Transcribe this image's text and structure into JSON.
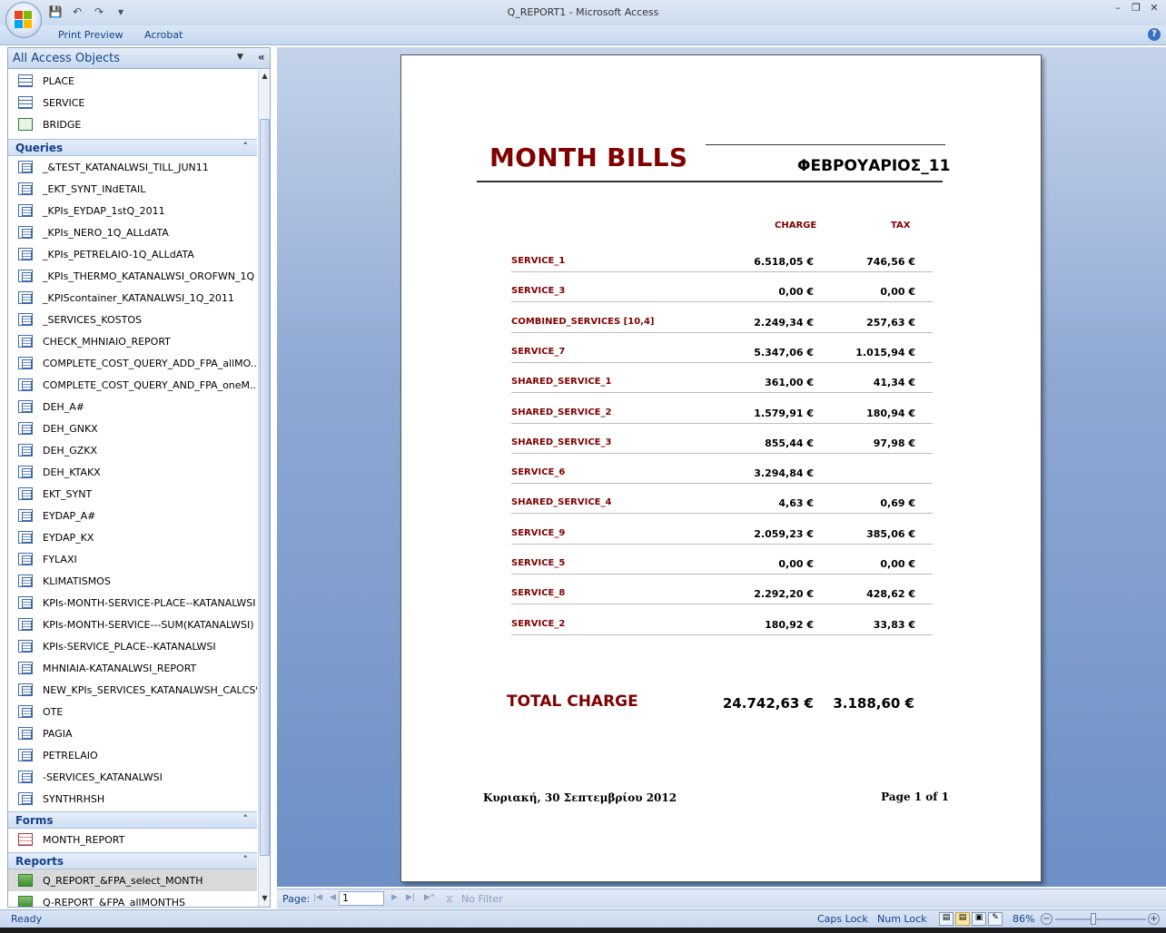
{
  "window": {
    "title": "Q_REPORT1 - Microsoft Access"
  },
  "ribbon": {
    "tabs": [
      "Print Preview",
      "Acrobat"
    ]
  },
  "nav": {
    "header": "All Access Objects",
    "tables": [
      "PLACE",
      "SERVICE",
      "BRIDGE"
    ],
    "groups": {
      "queries": "Queries",
      "forms": "Forms",
      "reports": "Reports"
    },
    "queries": [
      "_&TEST_KATANALWSI_TILL_JUN11",
      "_EKT_SYNT_INdETAIL",
      "_KPIs_EYDAP_1stQ_2011",
      "_KPIs_NERO_1Q_ALLdATA",
      "_KPIs_PETRELAIO-1Q_ALLdATA",
      "_KPIs_THERMO_KATANALWSI_OROFWN_1Q",
      "_KPIScontainer_KATANALWSI_1Q_2011",
      "_SERVICES_KOSTOS",
      "CHECK_MHNIAIO_REPORT",
      "COMPLETE_COST_QUERY_ADD_FPA_allMO...",
      "COMPLETE_COST_QUERY_AND_FPA_oneM...",
      "DEH_A#",
      "DEH_GNKX",
      "DEH_GZKX",
      "DEH_KTAKX",
      "EKT_SYNT",
      "EYDAP_A#",
      "EYDAP_KX",
      "FYLAXI",
      "KLIMATISMOS",
      "KPIs-MONTH-SERVICE-PLACE--KATANALWSI",
      "KPIs-MONTH-SERVICE---SUM(KATANALWSI)",
      "KPIs-SERVICE_PLACE--KATANALWSI",
      "MHNIAIA-KATANALWSI_REPORT",
      "NEW_KPIs_SERVICES_KATANALWSH_CALCS%",
      "OTE",
      "PAGIA",
      "PETRELAIO",
      "-SERVICES_KATANALWSI",
      "SYNTHRHSH"
    ],
    "forms": [
      "MONTH_REPORT"
    ],
    "reports": [
      "Q_REPORT_&FPA_select_MONTH",
      "Q-REPORT_&FPA_allMONTHS"
    ]
  },
  "report": {
    "title": "MONTH BILLS",
    "month": "ΦΕΒΡΟΥΑΡΙΟΣ_11",
    "col_charge": "CHARGE",
    "col_tax": "TAX",
    "rows": [
      {
        "name": "SERVICE_1",
        "charge": "6.518,05 €",
        "tax": "746,56 €"
      },
      {
        "name": "SERVICE_3",
        "charge": "0,00 €",
        "tax": "0,00 €"
      },
      {
        "name": "COMBINED_SERVICES [10,4]",
        "charge": "2.249,34 €",
        "tax": "257,63 €"
      },
      {
        "name": "SERVICE_7",
        "charge": "5.347,06 €",
        "tax": "1.015,94 €"
      },
      {
        "name": "SHARED_SERVICE_1",
        "charge": "361,00 €",
        "tax": "41,34 €"
      },
      {
        "name": "SHARED_SERVICE_2",
        "charge": "1.579,91 €",
        "tax": "180,94 €"
      },
      {
        "name": "SHARED_SERVICE_3",
        "charge": "855,44 €",
        "tax": "97,98 €"
      },
      {
        "name": "SERVICE_6",
        "charge": "3.294,84 €",
        "tax": ""
      },
      {
        "name": "SHARED_SERVICE_4",
        "charge": "4,63 €",
        "tax": "0,69 €"
      },
      {
        "name": "SERVICE_9",
        "charge": "2.059,23 €",
        "tax": "385,06 €"
      },
      {
        "name": "SERVICE_5",
        "charge": "0,00 €",
        "tax": "0,00 €"
      },
      {
        "name": "SERVICE_8",
        "charge": "2.292,20 €",
        "tax": "428,62 €"
      },
      {
        "name": "SERVICE_2",
        "charge": "180,92 €",
        "tax": "33,83 €"
      }
    ],
    "total_label": "TOTAL CHARGE",
    "total_charge": "24.742,63 €",
    "total_tax": "3.188,60 €",
    "footer_date": "Κυριακή, 30 Σεπτεμβρίου 2012",
    "footer_page": "Page 1 of 1"
  },
  "recnav": {
    "page_label": "Page:",
    "page_value": "1",
    "filter_label": "No Filter"
  },
  "status": {
    "ready": "Ready",
    "caps": "Caps Lock",
    "num": "Num Lock",
    "zoom": "86%"
  }
}
